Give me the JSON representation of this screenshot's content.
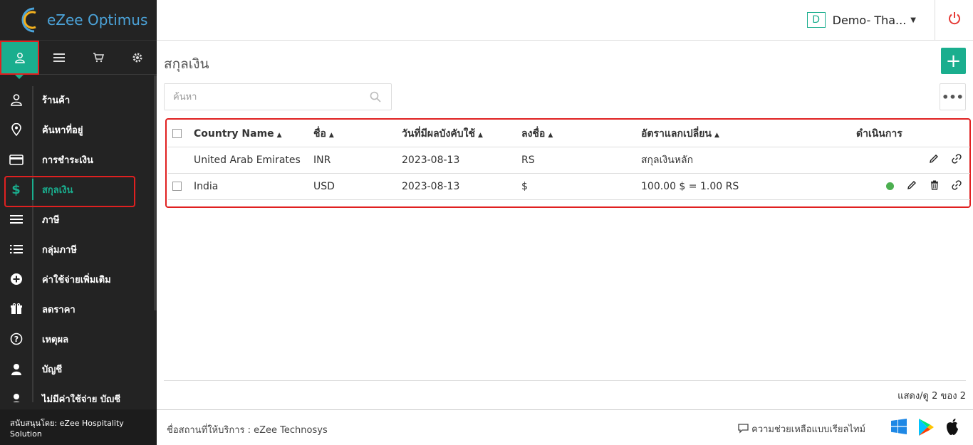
{
  "brand": {
    "name": "eZee Optimus"
  },
  "header": {
    "property_badge": "D",
    "property_name": "Demo- Tha..."
  },
  "sidebar": {
    "items": [
      {
        "label": "ร้านค้า"
      },
      {
        "label": "ค้นหาที่อยู่"
      },
      {
        "label": "การชำระเงิน"
      },
      {
        "label": "สกุลเงิน"
      },
      {
        "label": "ภาษี"
      },
      {
        "label": "กลุ่มภาษี"
      },
      {
        "label": "ค่าใช้จ่ายเพิ่มเติม"
      },
      {
        "label": "ลดราคา"
      },
      {
        "label": "เหตุผล"
      },
      {
        "label": "บัญชี"
      },
      {
        "label": "ไม่มีค่าใช้จ่าย บัญชี"
      }
    ],
    "footer": "สนับสนุนโดย: eZee Hospitality Solution"
  },
  "main": {
    "title": "สกุลเงิน",
    "search_placeholder": "ค้นหา",
    "columns": [
      "Country Name",
      "ชื่อ",
      "วันที่มีผลบังคับใช้",
      "ลงชื่อ",
      "อัตราแลกเปลี่ยน",
      "ดำเนินการ"
    ],
    "rows": [
      {
        "country": "United Arab Emirates",
        "name": "INR",
        "date": "2023-08-13",
        "symbol": "RS",
        "rate": "สกุลเงินหลัก"
      },
      {
        "country": "India",
        "name": "USD",
        "date": "2023-08-13",
        "symbol": "$",
        "rate": "100.00 $ = 1.00 RS"
      }
    ],
    "count_text": "แสดง/ดู 2 ของ 2"
  },
  "footer": {
    "provider": "ชื่อสถานที่ให้บริการ : eZee Technosys",
    "help": "ความช่วยเหลือแบบเรียลไทม์"
  },
  "colors": {
    "accent": "#1aae8e",
    "highlight": "#e02020",
    "sidebar_bg": "#232323",
    "active_dot": "#4caf50",
    "power": "#e53935"
  }
}
